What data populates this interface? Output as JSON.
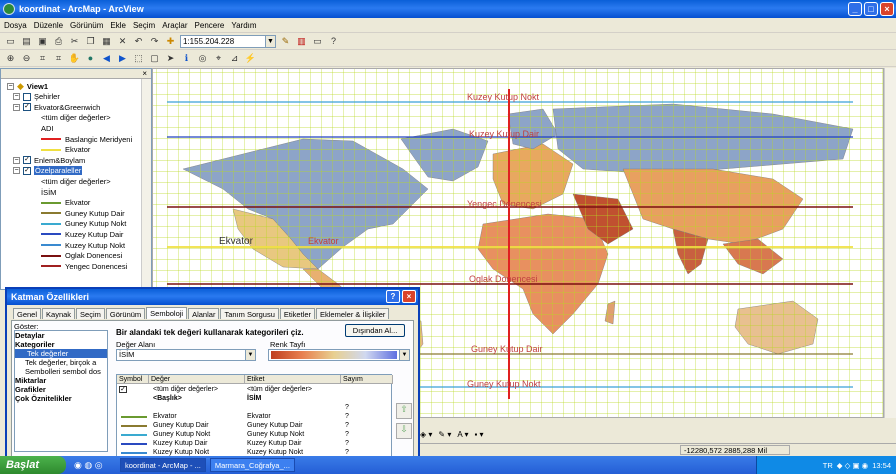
{
  "window": {
    "title": "koordinat - ArcMap - ArcView"
  },
  "menu": [
    "Dosya",
    "Düzenle",
    "Görünüm",
    "Ekle",
    "Seçim",
    "Araçlar",
    "Pencere",
    "Yardım"
  ],
  "toolbar": {
    "scale": "1:155.204.228"
  },
  "toc": {
    "close": "×",
    "items": [
      {
        "label": "View1",
        "type": "frame"
      },
      {
        "label": "Şehirler",
        "type": "layer",
        "checked": false
      },
      {
        "label": "Ekvator&Greenwich",
        "type": "layer",
        "checked": true
      },
      {
        "label": "<tüm diğer değerler>",
        "type": "legend"
      },
      {
        "label": "ADI",
        "type": "legend"
      },
      {
        "label": "Baslangic Meridyeni",
        "type": "legend",
        "color": "#e02020"
      },
      {
        "label": "Ekvator",
        "type": "legend",
        "color": "#f0e040"
      },
      {
        "label": "Enlem&Boylam",
        "type": "layer",
        "checked": true
      },
      {
        "label": "Özelparaleller",
        "type": "layer",
        "checked": true,
        "selected": true
      },
      {
        "label": "<tüm diğer değerler>",
        "type": "legend"
      },
      {
        "label": "İSİM",
        "type": "legend"
      },
      {
        "label": "Ekvator",
        "type": "legend",
        "color": "#6a9a30"
      },
      {
        "label": "Guney Kutup Dair",
        "type": "legend",
        "color": "#8a7a30"
      },
      {
        "label": "Guney Kutup Nokt",
        "type": "legend",
        "color": "#3aaad0"
      },
      {
        "label": "Kuzey Kutup Dair",
        "type": "legend",
        "color": "#2a4ac0"
      },
      {
        "label": "Kuzey Kutup Nokt",
        "type": "legend",
        "color": "#3a8ad0"
      },
      {
        "label": "Oglak Donencesi",
        "type": "legend",
        "color": "#7a1010"
      },
      {
        "label": "Yengec Donencesi",
        "type": "legend",
        "color": "#a02020"
      }
    ]
  },
  "map": {
    "labels": {
      "kuzey_nokt": "Kuzey Kutup Nokt",
      "kuzey_dair": "Kuzey Kutup Dair",
      "yengec": "Yengec Donencesi",
      "ekvator1": "Ekvator",
      "ekvator2": "Ekvator",
      "oglak": "Oglak Donencesi",
      "guney_dair": "Guney Kutup Dair",
      "guney_nokt": "Guney Kutup Nokt"
    }
  },
  "status": {
    "coords": "-12280,572  2885,288 Mil"
  },
  "dialog": {
    "title": "Katman Özellikleri",
    "tabs": [
      "Genel",
      "Kaynak",
      "Seçim",
      "Görünüm",
      "Semboloji",
      "Alanlar",
      "Tanım Sorgusu",
      "Etiketler",
      "Eklemeler & İlişkiler"
    ],
    "selected_tab": "Semboloji",
    "show_label": "Göster:",
    "show_items": [
      {
        "label": "Detaylar",
        "bold": true
      },
      {
        "label": "Kategoriler",
        "bold": true
      },
      {
        "label": "Tek değerler",
        "selected": true
      },
      {
        "label": "Tek değerler, birçok a",
        "bold": false
      },
      {
        "label": "Sembolleri sembol dos",
        "bold": false
      },
      {
        "label": "Miktarlar",
        "bold": true
      },
      {
        "label": "Grafikler",
        "bold": true
      },
      {
        "label": "Çok Öznitelikler",
        "bold": true
      }
    ],
    "header": "Bir alandaki tek değeri kullanarak kategorileri çiz.",
    "import_btn": "Dışından Al...",
    "value_field_label": "Değer Alanı",
    "value_field": "İSİM",
    "color_ramp_label": "Renk Tayfı",
    "columns": [
      "Symbol",
      "Değer",
      "Etiket",
      "Sayım"
    ],
    "rows": [
      {
        "value": "<tüm diğer değerler>",
        "label": "<tüm diğer değerler>",
        "count": "",
        "color": "",
        "check": true
      },
      {
        "value": "<Başlık>",
        "label": "İSİM",
        "count": "",
        "color": "",
        "bold": true
      },
      {
        "value": "",
        "label": "",
        "count": "?",
        "color": ""
      },
      {
        "value": "Ekvator",
        "label": "Ekvator",
        "count": "?",
        "color": "#6a9a30"
      },
      {
        "value": "Guney Kutup Dair",
        "label": "Guney Kutup Dair",
        "count": "?",
        "color": "#8a7a30"
      },
      {
        "value": "Guney Kutup Nokt",
        "label": "Guney Kutup Nokt",
        "count": "?",
        "color": "#3aaad0"
      },
      {
        "value": "Kuzey Kutup Dair",
        "label": "Kuzey Kutup Dair",
        "count": "?",
        "color": "#2a4ac0"
      },
      {
        "value": "Kuzey Kutup Nokt",
        "label": "Kuzey Kutup Nokt",
        "count": "?",
        "color": "#3a8ad0"
      }
    ]
  },
  "taskbar": {
    "start": "Başlat",
    "tasks": [
      "koordinat - ArcMap - ...",
      "Marmara_Coğrafya_..."
    ],
    "lang": "TR",
    "time": "13:54"
  }
}
